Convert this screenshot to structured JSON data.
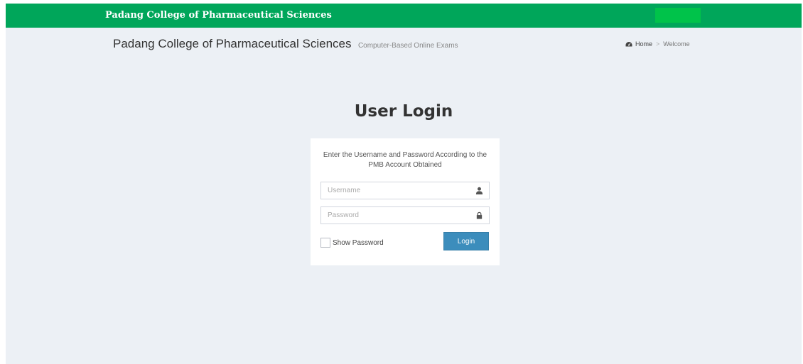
{
  "topbar": {
    "brand": "Padang College of Pharmaceutical Sciences",
    "bg_color": "#00a65a",
    "button_color": "#00c34a"
  },
  "header": {
    "title": "Padang College of Pharmaceutical Sciences",
    "subtitle": "Computer-Based Online Exams"
  },
  "breadcrumb": {
    "home_icon": "dashboard-icon",
    "home": "Home",
    "separator": ">",
    "current": "Welcome"
  },
  "login": {
    "title": "User Login",
    "message": "Enter the Username and Password According to the PMB Account Obtained",
    "username": {
      "placeholder": "Username",
      "value": "",
      "icon": "user-icon"
    },
    "password": {
      "placeholder": "Password",
      "value": "",
      "icon": "lock-icon"
    },
    "show_password": {
      "label": "Show Password",
      "checked": false
    },
    "button": "Login",
    "button_color": "#3c8dbc"
  },
  "page_bg": "#ecf0f5"
}
